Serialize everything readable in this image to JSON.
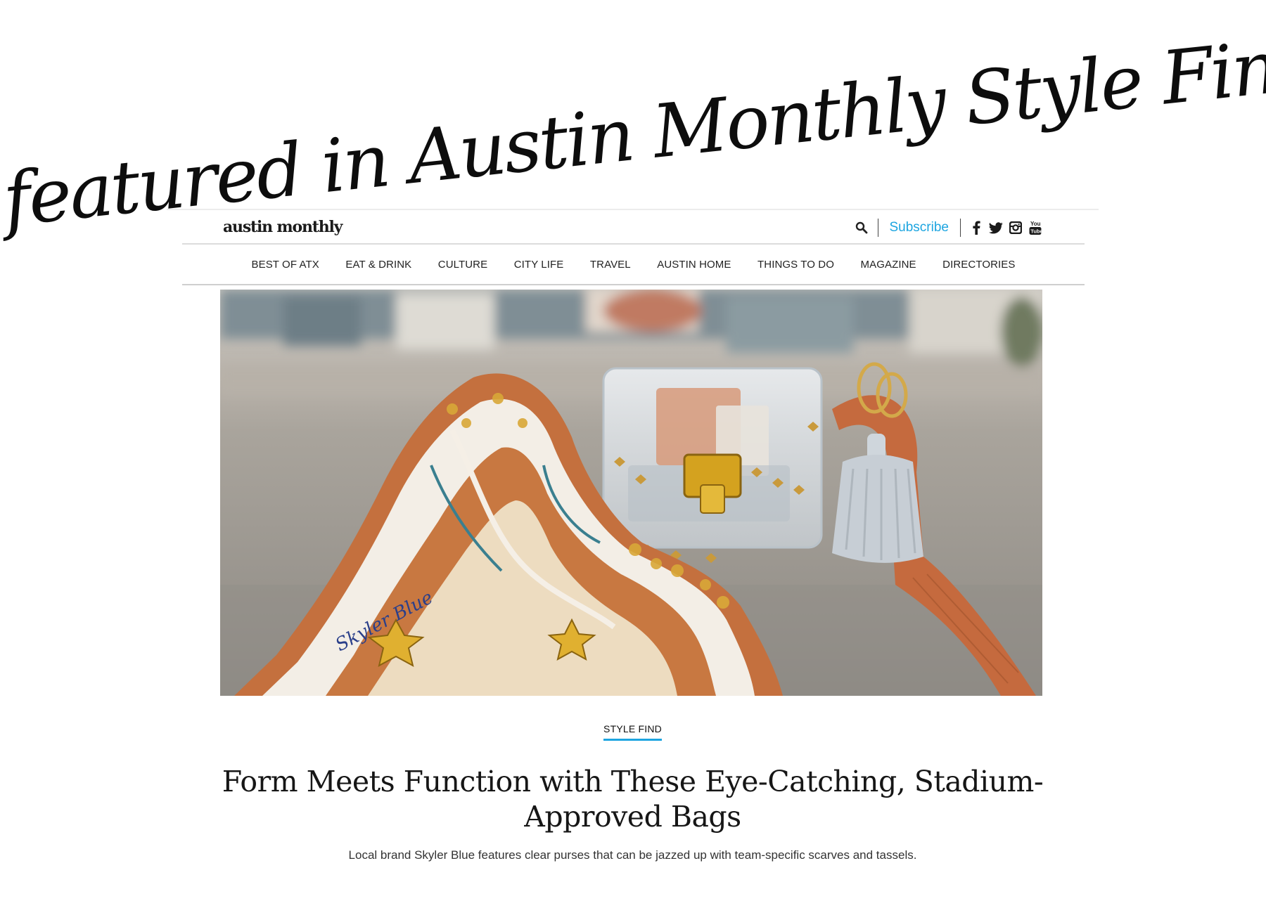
{
  "banner": {
    "title": "As featured in Austin Monthly Style Finds!"
  },
  "site": {
    "logo": "austin monthly",
    "subscribe_label": "Subscribe",
    "social_icons": [
      "facebook-icon",
      "twitter-icon",
      "instagram-icon",
      "youtube-icon"
    ],
    "accent_color": "#1da5e0"
  },
  "nav": {
    "items": [
      {
        "label": "BEST OF ATX"
      },
      {
        "label": "EAT & DRINK"
      },
      {
        "label": "CULTURE"
      },
      {
        "label": "CITY LIFE"
      },
      {
        "label": "TRAVEL"
      },
      {
        "label": "AUSTIN HOME"
      },
      {
        "label": "THINGS TO DO"
      },
      {
        "label": "MAGAZINE"
      },
      {
        "label": "DIRECTORIES"
      }
    ]
  },
  "hero": {
    "scarf_brand": "Skyler Blue"
  },
  "article": {
    "category": "STYLE FIND",
    "headline": "Form Meets Function with These Eye-Catching, Stadium-Approved Bags",
    "dek": "Local brand Skyler Blue features clear purses that can be jazzed up with team-specific scarves and tassels."
  }
}
